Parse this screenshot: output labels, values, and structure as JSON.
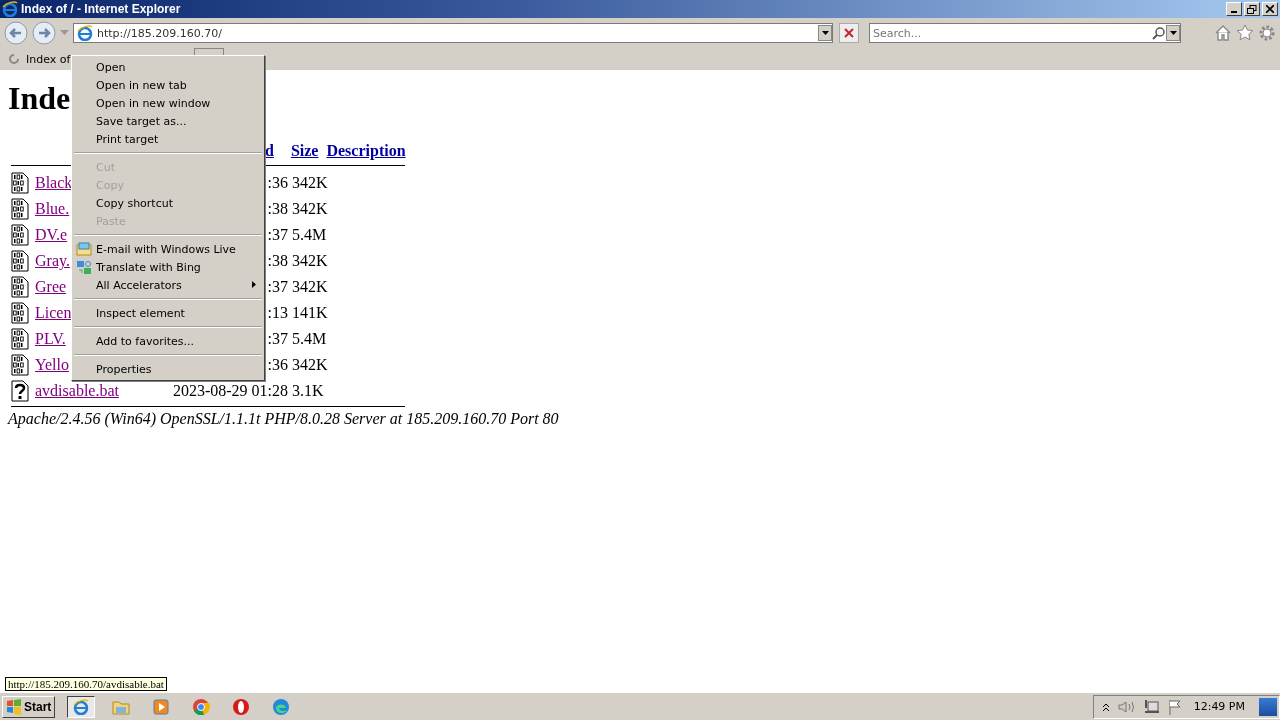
{
  "window": {
    "title": "Index of / - Internet Explorer"
  },
  "address_bar": {
    "value": "http://185.209.160.70/"
  },
  "search": {
    "placeholder": "Search..."
  },
  "tab": {
    "label": "Index of"
  },
  "page": {
    "heading": "Inde",
    "columns": [
      "d",
      "Size",
      "Description"
    ],
    "rows": [
      {
        "name": "Black",
        "modified": ":36",
        "size": "342K",
        "kind": "binary"
      },
      {
        "name": "Blue.",
        "modified": ":38",
        "size": "342K",
        "kind": "binary"
      },
      {
        "name": "DV.e",
        "modified": ":37",
        "size": "5.4M",
        "kind": "binary"
      },
      {
        "name": "Gray.",
        "modified": ":38",
        "size": "342K",
        "kind": "binary"
      },
      {
        "name": "Gree",
        "modified": ":37",
        "size": "342K",
        "kind": "binary"
      },
      {
        "name": "Licen",
        "modified": ":13",
        "size": "141K",
        "kind": "binary"
      },
      {
        "name": "PLV.",
        "modified": ":37",
        "size": "5.4M",
        "kind": "binary"
      },
      {
        "name": "Yello",
        "modified": ":36",
        "size": "342K",
        "kind": "binary"
      },
      {
        "name": "avdisable.bat",
        "modified": "2023-08-29 01:28",
        "size": "3.1K",
        "kind": "unknown"
      }
    ],
    "footer": "Apache/2.4.56 (Win64) OpenSSL/1.1.1t PHP/8.0.28 Server at 185.209.160.70 Port 80"
  },
  "context_menu": {
    "items": [
      {
        "kind": "item",
        "label": "Open",
        "disabled": false
      },
      {
        "kind": "item",
        "label": "Open in new tab",
        "disabled": false
      },
      {
        "kind": "item",
        "label": "Open in new window",
        "disabled": false
      },
      {
        "kind": "item",
        "label": "Save target as...",
        "disabled": false
      },
      {
        "kind": "item",
        "label": "Print target",
        "disabled": false
      },
      {
        "kind": "separator"
      },
      {
        "kind": "item",
        "label": "Cut",
        "disabled": true
      },
      {
        "kind": "item",
        "label": "Copy",
        "disabled": true
      },
      {
        "kind": "item",
        "label": "Copy shortcut",
        "disabled": false
      },
      {
        "kind": "item",
        "label": "Paste",
        "disabled": true
      },
      {
        "kind": "separator"
      },
      {
        "kind": "mail",
        "label": "E-mail with Windows Live",
        "disabled": false
      },
      {
        "kind": "translate",
        "label": "Translate with Bing",
        "disabled": false
      },
      {
        "kind": "submenu",
        "label": "All Accelerators",
        "disabled": false
      },
      {
        "kind": "separator"
      },
      {
        "kind": "item",
        "label": "Inspect element",
        "disabled": false
      },
      {
        "kind": "separator"
      },
      {
        "kind": "item",
        "label": "Add to favorites...",
        "disabled": false
      },
      {
        "kind": "separator"
      },
      {
        "kind": "item",
        "label": "Properties",
        "disabled": false
      }
    ]
  },
  "status_tooltip": "http://185.209.160.70/avdisable.bat",
  "taskbar": {
    "start": "Start",
    "clock": "12:49 PM"
  }
}
